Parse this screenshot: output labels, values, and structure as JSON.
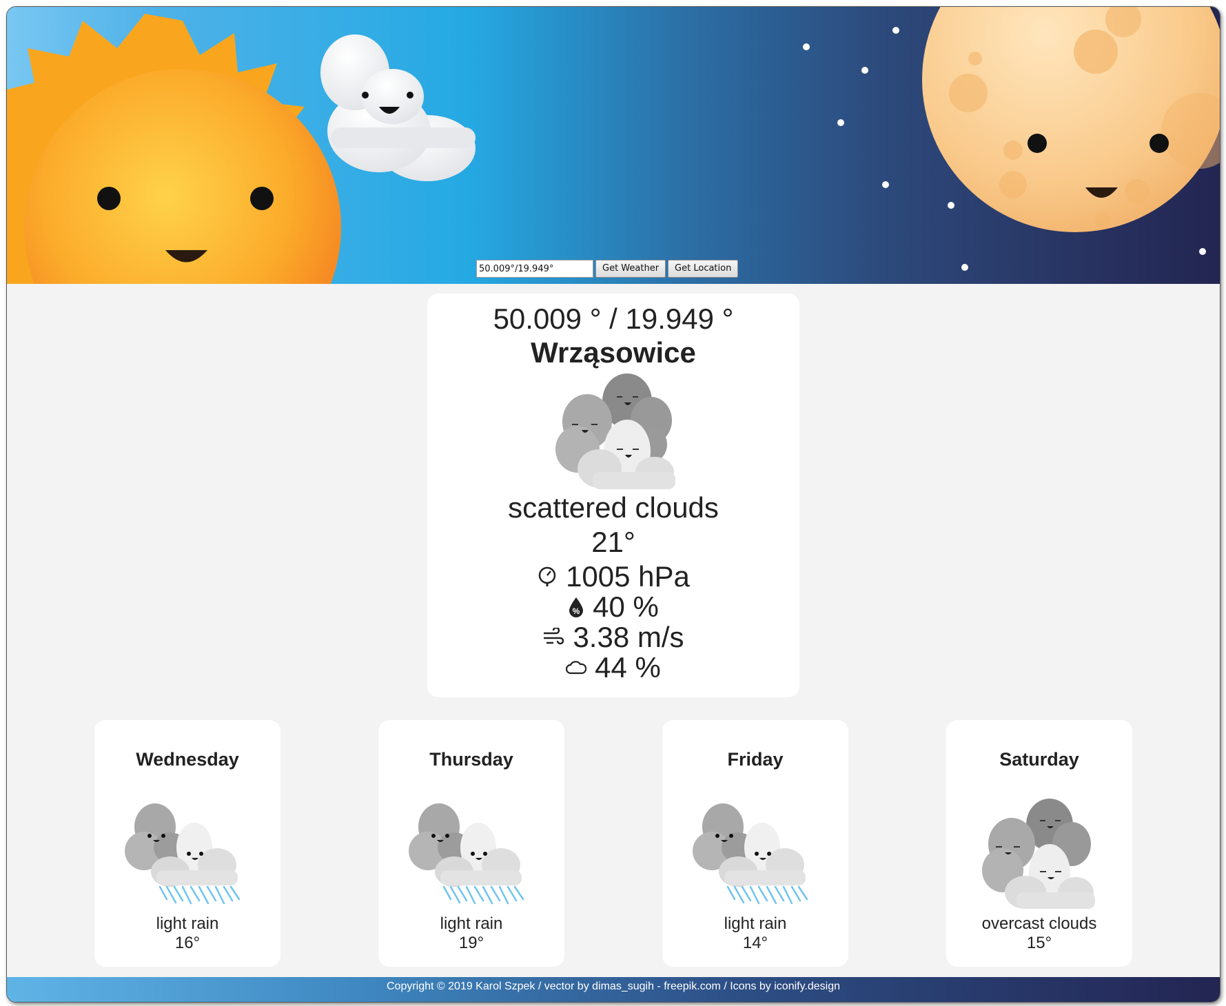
{
  "search": {
    "value": "50.009°/19.949°",
    "get_weather_label": "Get Weather",
    "get_location_label": "Get Location"
  },
  "current": {
    "coords": "50.009 ° / 19.949 °",
    "city": "Wrząsowice",
    "icon": "cloudy-faces-icon",
    "description": "scattered clouds",
    "temperature": "21°",
    "pressure": "1005 hPa",
    "humidity": "40 %",
    "wind": "3.38 m/s",
    "cloudiness": "44 %"
  },
  "forecast": [
    {
      "day": "Wednesday",
      "icon": "rain-cloud-icon",
      "description": "light rain",
      "temperature": "16°"
    },
    {
      "day": "Thursday",
      "icon": "rain-cloud-icon",
      "description": "light rain",
      "temperature": "19°"
    },
    {
      "day": "Friday",
      "icon": "rain-cloud-icon",
      "description": "light rain",
      "temperature": "14°"
    },
    {
      "day": "Saturday",
      "icon": "overcast-cloud-icon",
      "description": "overcast clouds",
      "temperature": "15°"
    }
  ],
  "footer": {
    "text": "Copyright © 2019 Karol Szpek / vector by dimas_sugih - freepik.com / Icons by iconify.design"
  },
  "colors": {
    "day_sky": "#25a9e3",
    "night_sky": "#232552",
    "sun": "#f7a51c",
    "moon": "#f9c98a",
    "card_bg": "#ffffff",
    "page_bg": "#f3f3f3"
  }
}
